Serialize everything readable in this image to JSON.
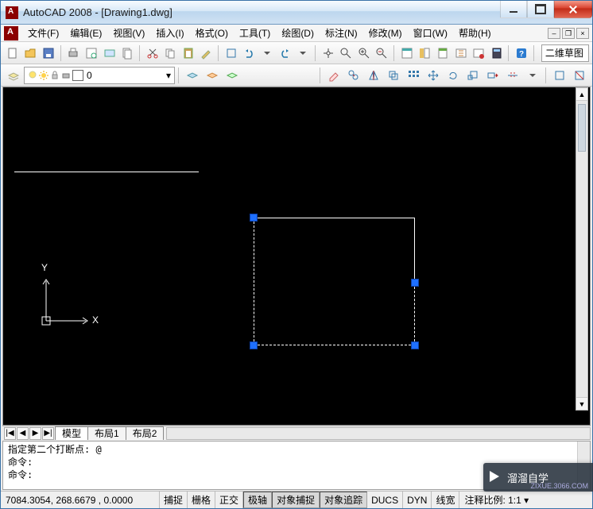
{
  "title": "AutoCAD 2008 - [Drawing1.dwg]",
  "menu": {
    "items": [
      {
        "label": "文件(F)"
      },
      {
        "label": "编辑(E)"
      },
      {
        "label": "视图(V)"
      },
      {
        "label": "插入(I)"
      },
      {
        "label": "格式(O)"
      },
      {
        "label": "工具(T)"
      },
      {
        "label": "绘图(D)"
      },
      {
        "label": "标注(N)"
      },
      {
        "label": "修改(M)"
      },
      {
        "label": "窗口(W)"
      },
      {
        "label": "帮助(H)"
      }
    ]
  },
  "toolbar1_right_box": "二维草图",
  "layer": {
    "current": "0"
  },
  "canvas": {
    "axes": {
      "x": "X",
      "y": "Y"
    }
  },
  "tabs": {
    "nav": [
      "|◀",
      "◀",
      "▶",
      "▶|"
    ],
    "items": [
      {
        "label": "模型",
        "active": true
      },
      {
        "label": "布局1",
        "active": false
      },
      {
        "label": "布局2",
        "active": false
      }
    ]
  },
  "command": {
    "lines": "指定第二个打断点: @\n命令:\n命令:"
  },
  "status": {
    "coords": "7084.3054, 268.6679 , 0.0000",
    "toggles": [
      {
        "label": "捕捉",
        "active": false
      },
      {
        "label": "栅格",
        "active": false
      },
      {
        "label": "正交",
        "active": false
      },
      {
        "label": "极轴",
        "active": true
      },
      {
        "label": "对象捕捉",
        "active": true
      },
      {
        "label": "对象追踪",
        "active": true
      },
      {
        "label": "DUCS",
        "active": false
      },
      {
        "label": "DYN",
        "active": false
      },
      {
        "label": "线宽",
        "active": false
      }
    ],
    "rest": "注释比例: 1:1 ▾"
  },
  "watermark": {
    "text": "溜溜自学",
    "sub": "ZIXUE.3066.COM"
  }
}
